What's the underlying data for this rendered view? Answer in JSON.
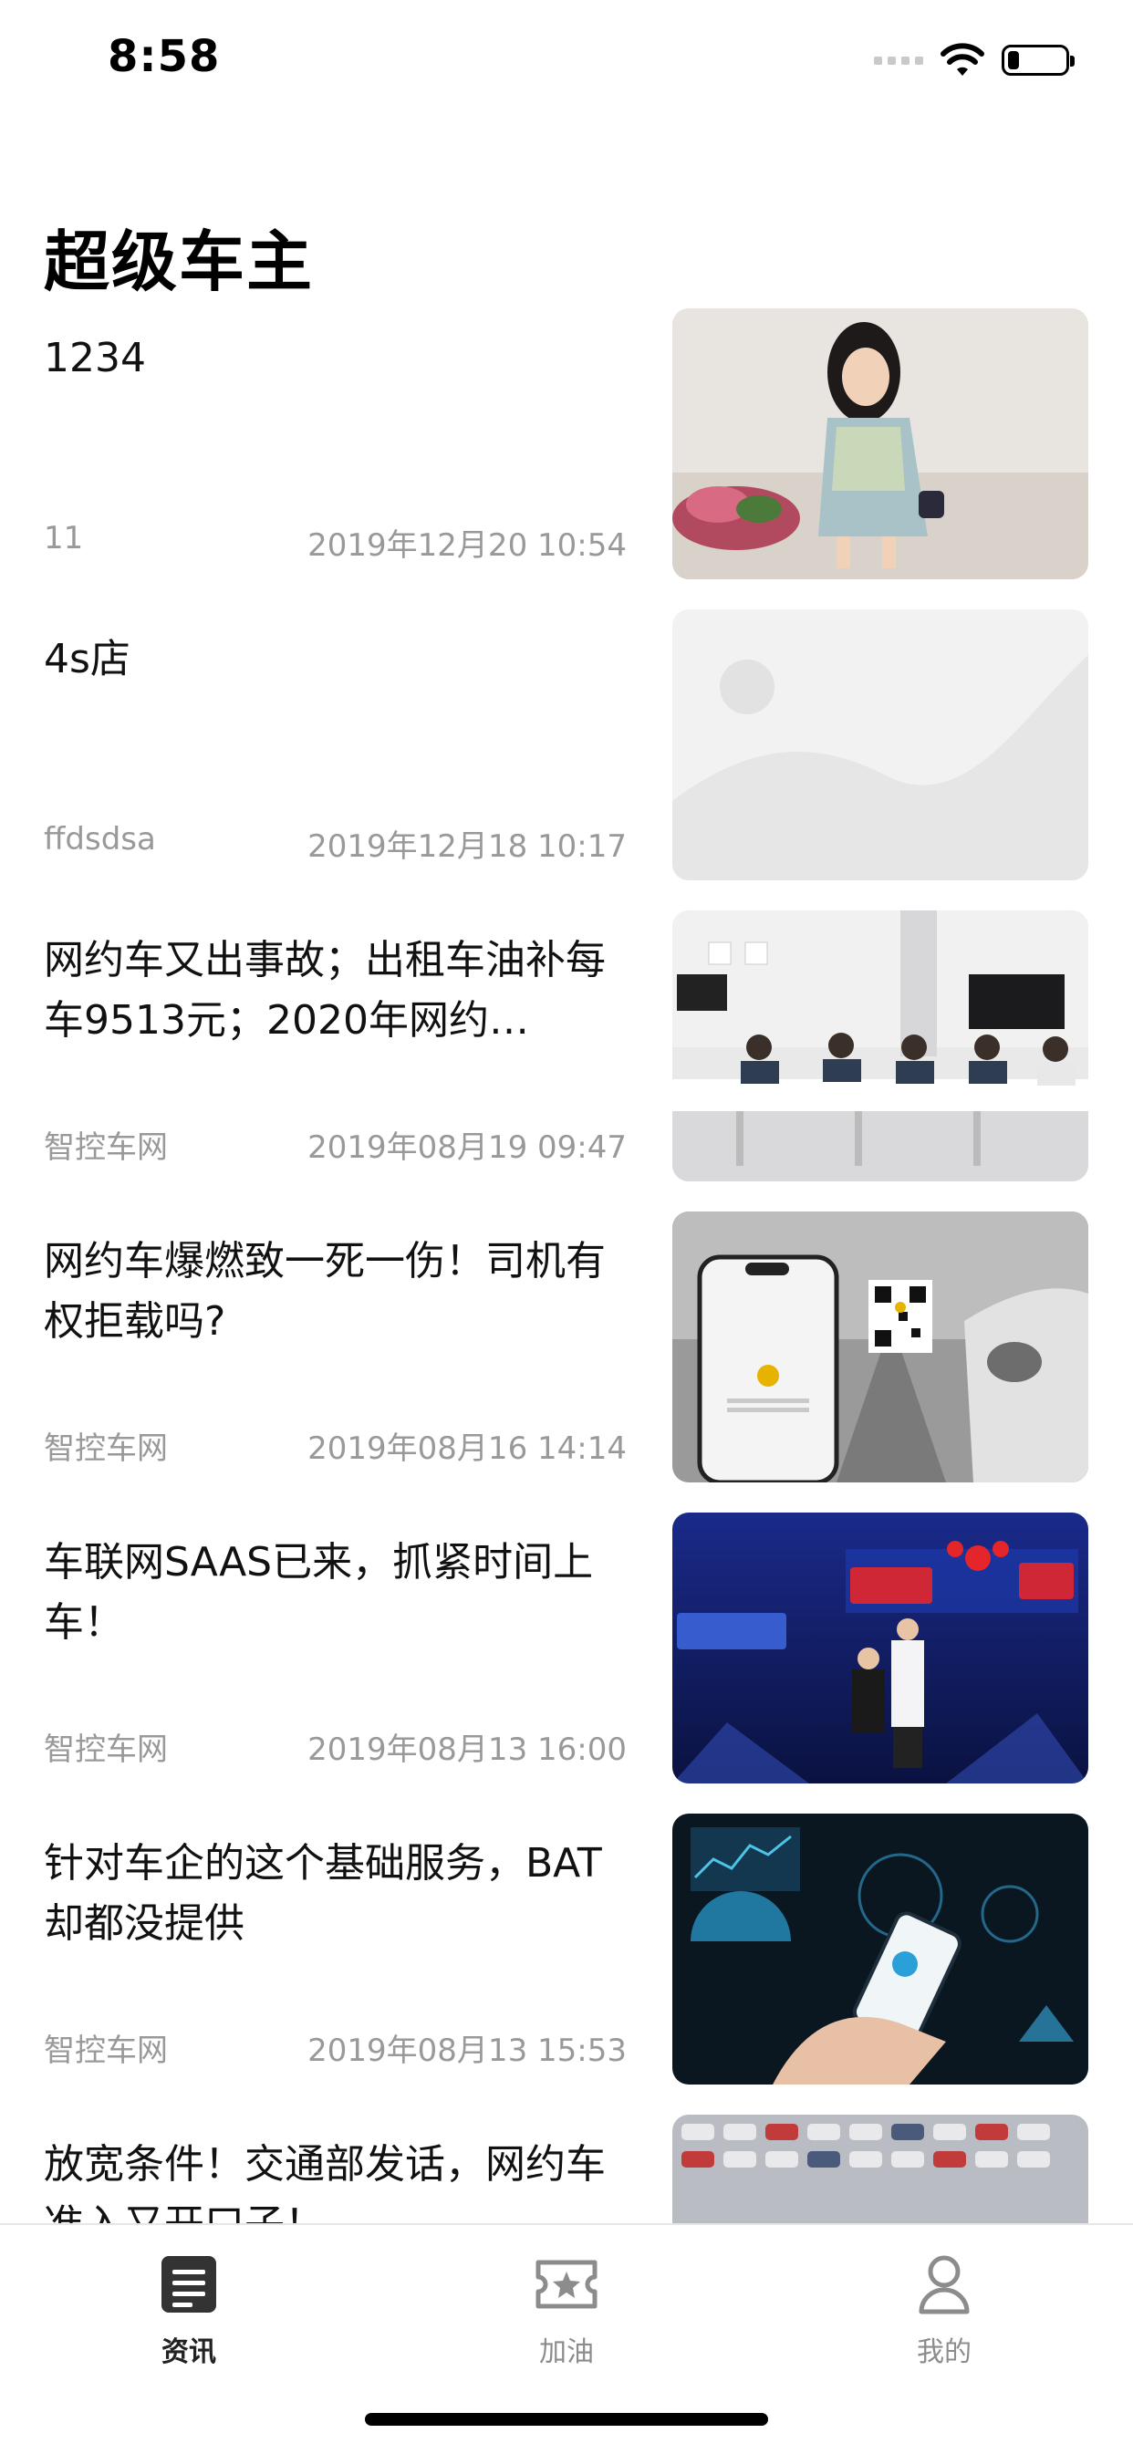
{
  "status_bar": {
    "time": "8:58",
    "battery_level": 0.2
  },
  "page": {
    "title": "超级车主"
  },
  "news": [
    {
      "title": "1234",
      "source": "11",
      "date": "2019年12月20 10:54",
      "image": "photo-girl"
    },
    {
      "title": "4s店",
      "source": "ffdsdsa",
      "date": "2019年12月18 10:17",
      "image": "placeholder-image"
    },
    {
      "title": "网约车又出事故；出租车油补每车9513元；2020年网约…",
      "source": "智控车网",
      "date": "2019年08月19 09:47",
      "image": "photo-meeting"
    },
    {
      "title": "网约车爆燃致一死一伤！司机有权拒载吗?",
      "source": "智控车网",
      "date": "2019年08月16 14:14",
      "image": "photo-phone-qr"
    },
    {
      "title": "车联网SAAS已来，抓紧时间上车！",
      "source": "智控车网",
      "date": "2019年08月13 16:00",
      "image": "photo-baidu-geely"
    },
    {
      "title": "针对车企的这个基础服务，BAT却都没提供",
      "source": "智控车网",
      "date": "2019年08月13 15:53",
      "image": "photo-hand-phone"
    },
    {
      "title": "放宽条件！交通部发话，网约车准入又开口子！",
      "source": "",
      "date": "",
      "image": "photo-cars-lot"
    }
  ],
  "tabs": [
    {
      "label": "资讯",
      "icon": "news-icon",
      "active": true
    },
    {
      "label": "加油",
      "icon": "ticket-star-icon",
      "active": false
    },
    {
      "label": "我的",
      "icon": "user-icon",
      "active": false
    }
  ],
  "colors": {
    "meta_text": "#999999",
    "tab_inactive": "#8c8c8c",
    "tab_active": "#222222"
  }
}
